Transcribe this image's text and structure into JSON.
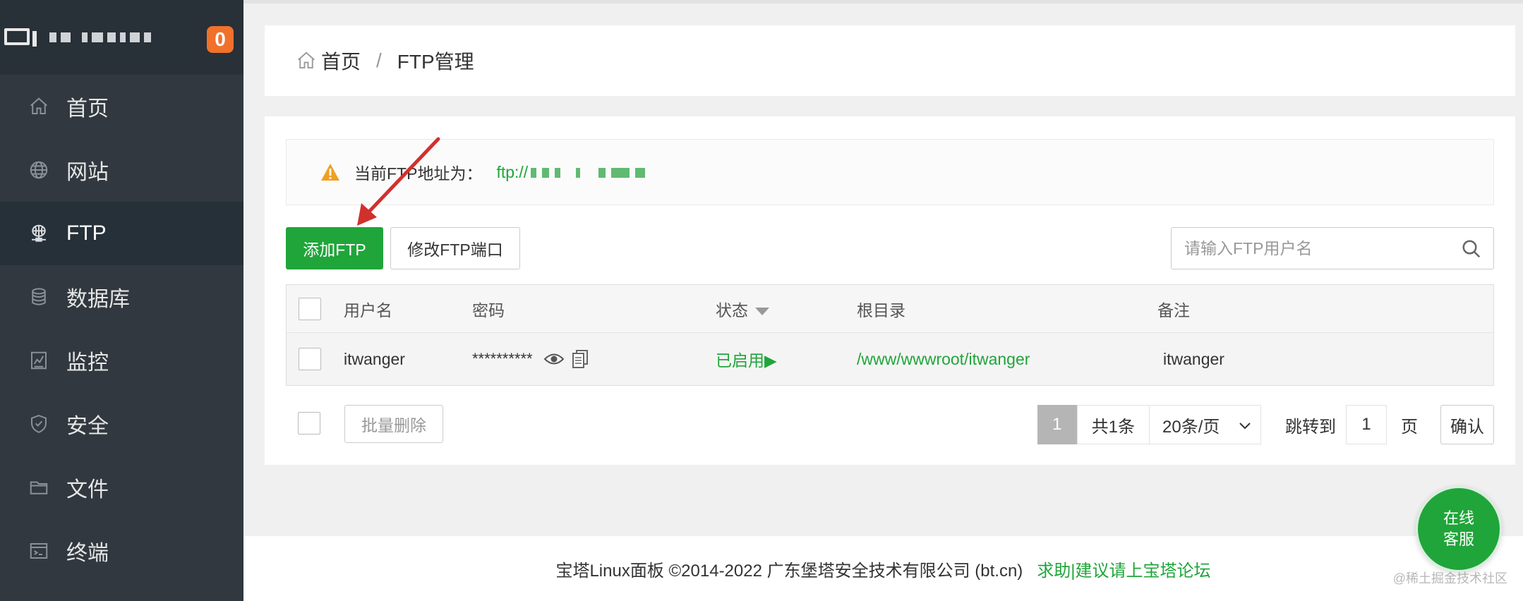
{
  "sidebar": {
    "badge": "0",
    "items": [
      {
        "label": "首页",
        "icon": "home-icon"
      },
      {
        "label": "网站",
        "icon": "globe-icon"
      },
      {
        "label": "FTP",
        "icon": "ftp-icon"
      },
      {
        "label": "数据库",
        "icon": "database-icon"
      },
      {
        "label": "监控",
        "icon": "monitor-icon"
      },
      {
        "label": "安全",
        "icon": "shield-icon"
      },
      {
        "label": "文件",
        "icon": "folder-icon"
      },
      {
        "label": "终端",
        "icon": "terminal-icon"
      }
    ],
    "active": "FTP"
  },
  "breadcrumb": {
    "home": "首页",
    "sep": "/",
    "current": "FTP管理"
  },
  "alert": {
    "text": "当前FTP地址为：",
    "address_prefix": "ftp://"
  },
  "toolbar": {
    "add_label": "添加FTP",
    "port_label": "修改FTP端口",
    "search_placeholder": "请输入FTP用户名"
  },
  "table": {
    "headers": {
      "user": "用户名",
      "password": "密码",
      "status": "状态",
      "root": "根目录",
      "note": "备注"
    },
    "rows": [
      {
        "user": "itwanger",
        "password": "**********",
        "status": "已启用▶",
        "root": "/www/wwwroot/itwanger",
        "note": "itwanger"
      }
    ]
  },
  "footer": {
    "batch_delete": "批量删除",
    "page": "1",
    "total": "共1条",
    "page_size": "20条/页",
    "jump_label": "跳转到",
    "jump_value": "1",
    "page_unit": "页",
    "confirm": "确认"
  },
  "site_footer": {
    "copyright": "宝塔Linux面板 ©2014-2022 广东堡塔安全技术有限公司 (bt.cn)",
    "help_link": "求助|建议请上宝塔论坛"
  },
  "chat": {
    "line1": "在线",
    "line2": "客服"
  },
  "watermark": "@稀土掘金技术社区",
  "colors": {
    "accent": "#20a53a",
    "sidebar": "#31383f",
    "badge": "#f0712a",
    "arrow": "#d0312d"
  }
}
